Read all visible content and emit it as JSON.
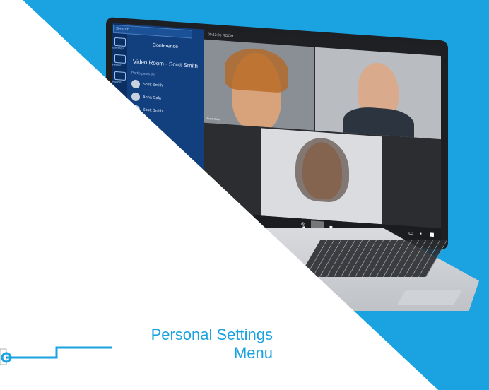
{
  "app": {
    "search_placeholder": "Search",
    "rail": [
      "Meetings",
      "People",
      "Rooms"
    ],
    "panel_title": "Conference",
    "room_title": "Video Room - Scott Smith",
    "participants_label": "Participants (6)",
    "participants": [
      "Scott Smith",
      "Anna Gala",
      "Scott Smith"
    ],
    "topbar_text": "00:12:05  ROOM",
    "tile_labels": [
      "Anna Gala",
      "",
      ""
    ]
  },
  "caption": {
    "line1": "Personal Settings",
    "line2": "Menu"
  },
  "colors": {
    "accent": "#1aa3e0",
    "sidebar": "#12407f"
  }
}
